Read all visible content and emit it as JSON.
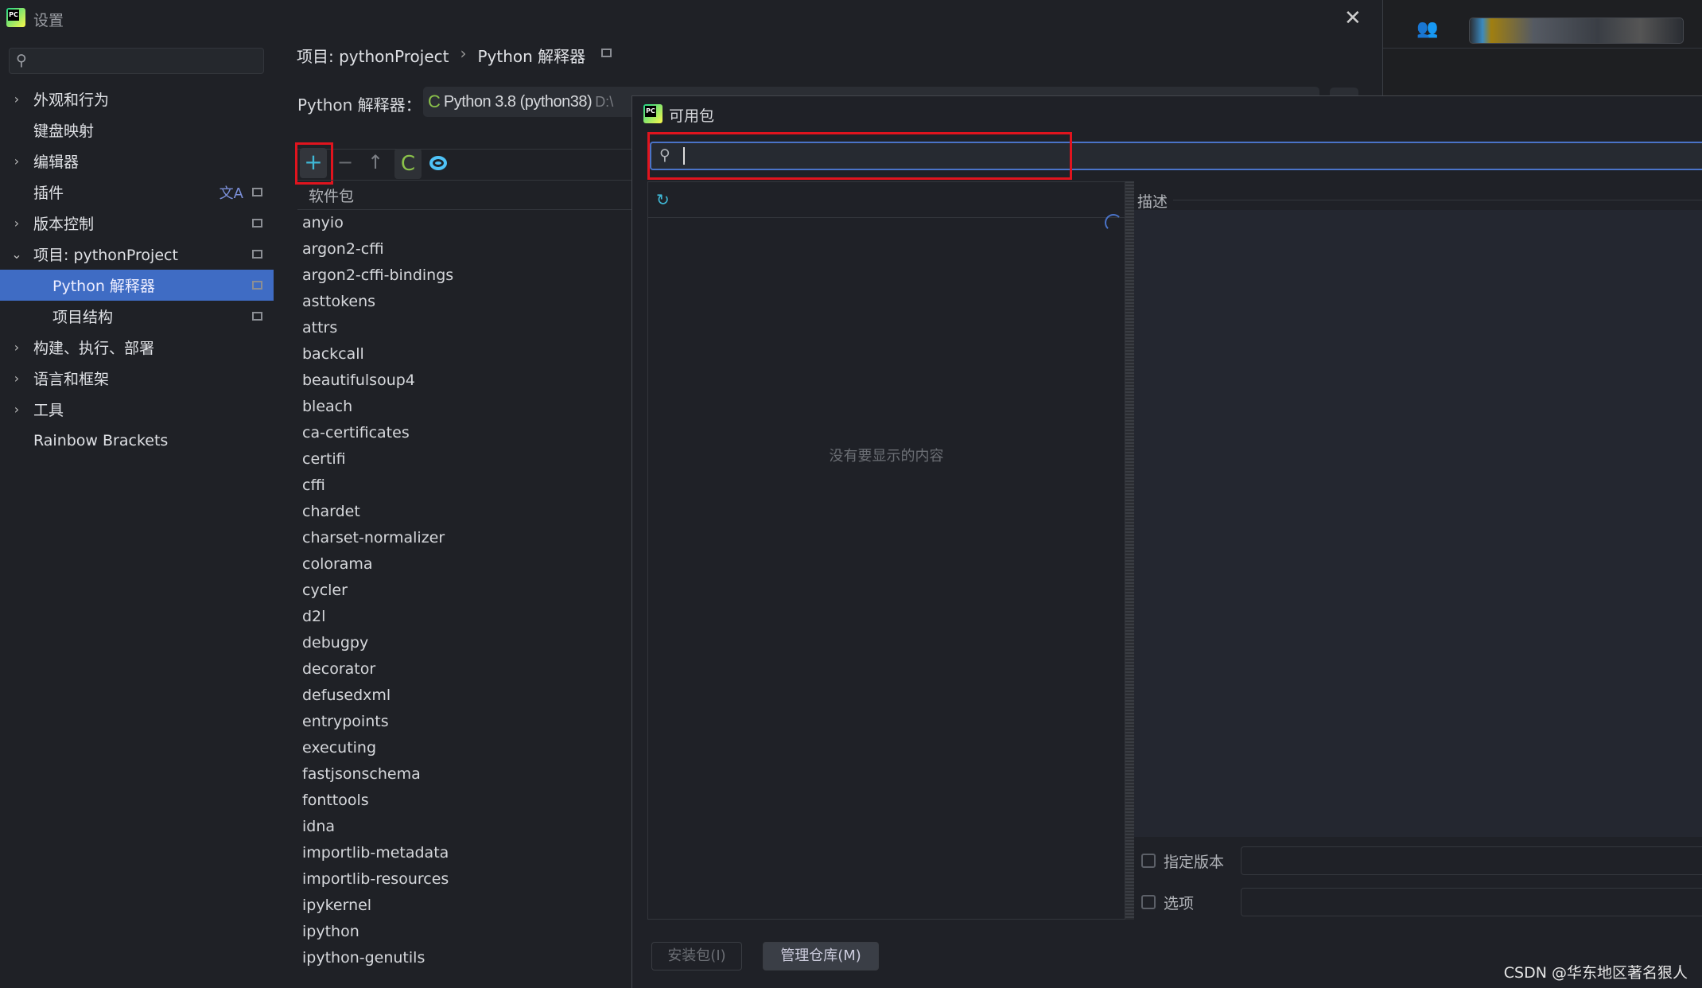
{
  "window": {
    "title": "设置",
    "close_icon": "close-icon"
  },
  "sidebar": {
    "search_placeholder": "",
    "items": [
      {
        "label": "外观和行为",
        "expandable": true,
        "expanded": false
      },
      {
        "label": "键盘映射",
        "expandable": false
      },
      {
        "label": "编辑器",
        "expandable": true,
        "expanded": false
      },
      {
        "label": "插件",
        "expandable": false
      },
      {
        "label": "版本控制",
        "expandable": true,
        "expanded": false
      },
      {
        "label": "项目: pythonProject",
        "expandable": true,
        "expanded": true
      },
      {
        "label": "Python 解释器",
        "child": true,
        "selected": true
      },
      {
        "label": "项目结构",
        "child": true
      },
      {
        "label": "构建、执行、部署",
        "expandable": true,
        "expanded": false
      },
      {
        "label": "语言和框架",
        "expandable": true,
        "expanded": false
      },
      {
        "label": "工具",
        "expandable": true,
        "expanded": false
      },
      {
        "label": "Rainbow Brackets",
        "expandable": false
      }
    ]
  },
  "breadcrumb": {
    "parent": "项目: pythonProject",
    "separator": "›",
    "current": "Python 解释器"
  },
  "interpreter": {
    "label": "Python 解释器：",
    "value": "Python 3.8 (python38)",
    "path_fragment": "D:\\"
  },
  "packages": {
    "header": "软件包",
    "items": [
      "anyio",
      "argon2-cffi",
      "argon2-cffi-bindings",
      "asttokens",
      "attrs",
      "backcall",
      "beautifulsoup4",
      "bleach",
      "ca-certificates",
      "certifi",
      "cffi",
      "chardet",
      "charset-normalizer",
      "colorama",
      "cycler",
      "d2l",
      "debugpy",
      "decorator",
      "defusedxml",
      "entrypoints",
      "executing",
      "fastjsonschema",
      "fonttools",
      "idna",
      "importlib-metadata",
      "importlib-resources",
      "ipykernel",
      "ipython",
      "ipython-genutils"
    ]
  },
  "dialog": {
    "title": "可用包",
    "search_value": "",
    "empty_text": "没有要显示的内容",
    "description_label": "描述",
    "specify_version": "指定版本",
    "options": "选项",
    "install_button": "安装包(I)",
    "manage_repos_button": "管理仓库(M)"
  },
  "watermark": "CSDN @华东地区著名狠人",
  "colors": {
    "selection": "#3f6cc4",
    "highlight": "#e0141e",
    "focus": "#4a73c8"
  }
}
